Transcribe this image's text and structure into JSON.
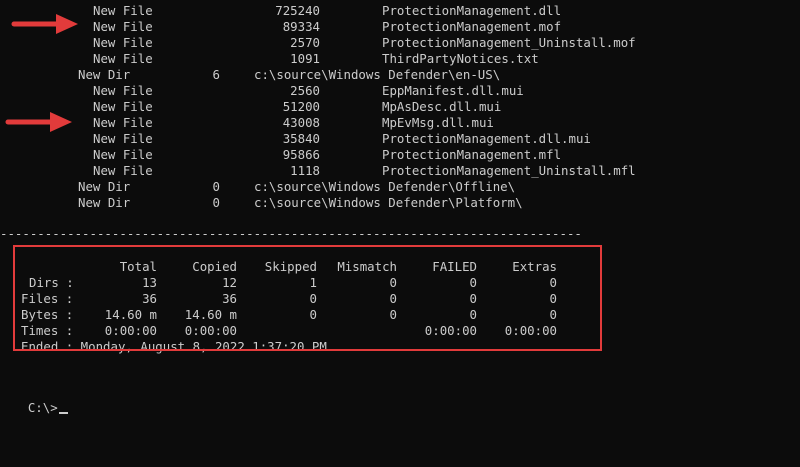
{
  "file_lines": [
    {
      "type": "New File",
      "size": "725240",
      "name": "ProtectionManagement.dll"
    },
    {
      "type": "New File",
      "size": "89334",
      "name": "ProtectionManagement.mof"
    },
    {
      "type": "New File",
      "size": "2570",
      "name": "ProtectionManagement_Uninstall.mof"
    },
    {
      "type": "New File",
      "size": "1091",
      "name": "ThirdPartyNotices.txt"
    },
    {
      "type": "New Dir",
      "size": "6",
      "name": "c:\\source\\Windows Defender\\en-US\\"
    },
    {
      "type": "New File",
      "size": "2560",
      "name": "EppManifest.dll.mui"
    },
    {
      "type": "New File",
      "size": "51200",
      "name": "MpAsDesc.dll.mui"
    },
    {
      "type": "New File",
      "size": "43008",
      "name": "MpEvMsg.dll.mui"
    },
    {
      "type": "New File",
      "size": "35840",
      "name": "ProtectionManagement.dll.mui"
    },
    {
      "type": "New File",
      "size": "95866",
      "name": "ProtectionManagement.mfl"
    },
    {
      "type": "New File",
      "size": "1118",
      "name": "ProtectionManagement_Uninstall.mfl"
    },
    {
      "type": "New Dir",
      "size": "0",
      "name": "c:\\source\\Windows Defender\\Offline\\"
    },
    {
      "type": "New Dir",
      "size": "0",
      "name": "c:\\source\\Windows Defender\\Platform\\"
    }
  ],
  "separator": "------------------------------------------------------------------------------",
  "summary": {
    "headers": [
      "Total",
      "Copied",
      "Skipped",
      "Mismatch",
      "FAILED",
      "Extras"
    ],
    "rows": [
      {
        "label": "Dirs :",
        "values": [
          "13",
          "12",
          "1",
          "0",
          "0",
          "0"
        ]
      },
      {
        "label": "Files :",
        "values": [
          "36",
          "36",
          "0",
          "0",
          "0",
          "0"
        ]
      },
      {
        "label": "Bytes :",
        "values": [
          "14.60 m",
          "14.60 m",
          "0",
          "0",
          "0",
          "0"
        ]
      },
      {
        "label": "Times :",
        "values": [
          "0:00:00",
          "0:00:00",
          "",
          "",
          "0:00:00",
          "0:00:00"
        ]
      }
    ],
    "ended": "Ended : Monday, August 8, 2022 1:37:20 PM"
  },
  "prompt": "C:\\>",
  "colors": {
    "background": "#0c0c0c",
    "text": "#cccccc",
    "annotation_red": "#e23b3b"
  }
}
